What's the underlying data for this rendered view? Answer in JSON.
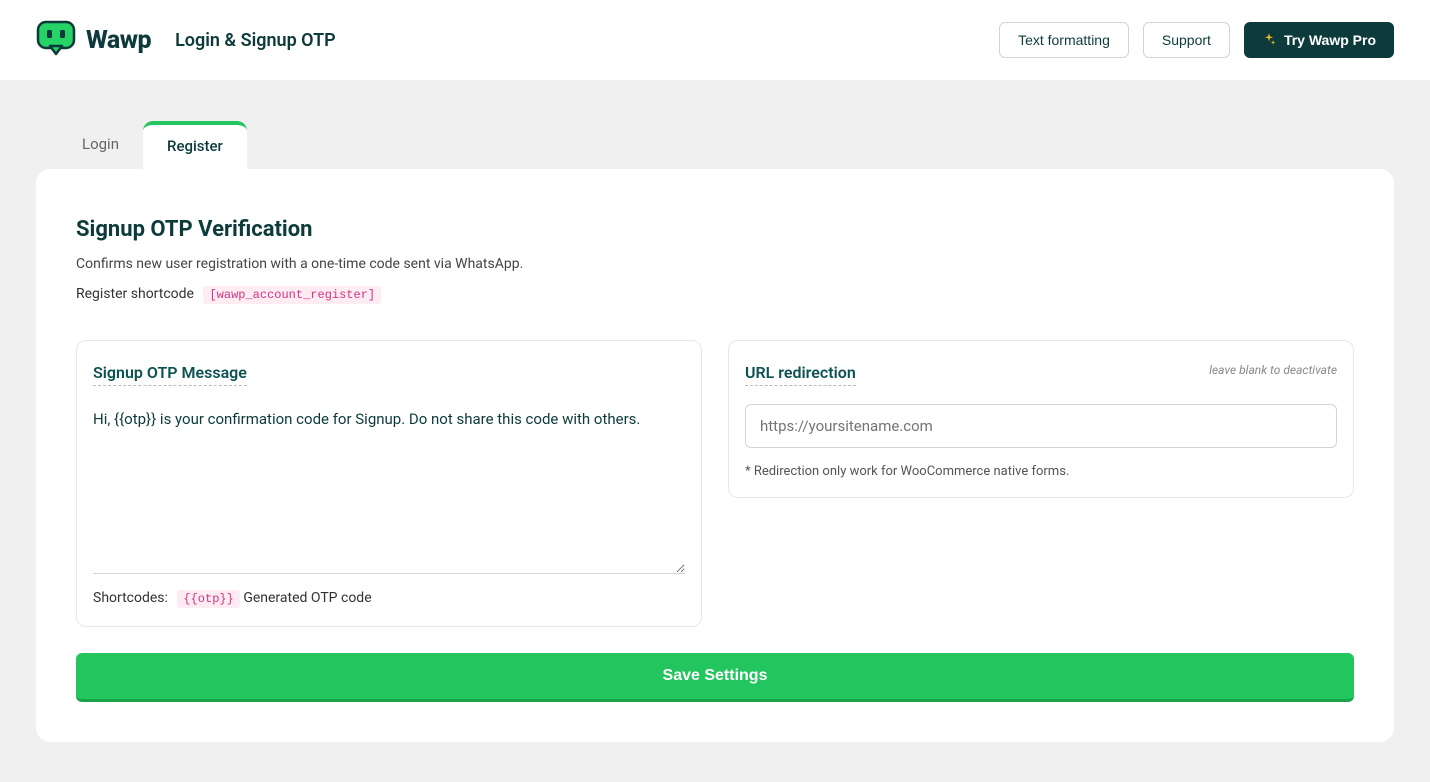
{
  "header": {
    "brand": "Wawp",
    "subtitle": "Login & Signup OTP",
    "text_formatting_btn": "Text formatting",
    "support_btn": "Support",
    "pro_btn": "Try Wawp Pro"
  },
  "tabs": {
    "login": "Login",
    "register": "Register"
  },
  "main": {
    "title": "Signup OTP Verification",
    "description": "Confirms new user registration with a one-time code sent via WhatsApp.",
    "register_shortcode_label": "Register shortcode",
    "register_shortcode_value": "[wawp_account_register]"
  },
  "message_panel": {
    "title": "Signup OTP Message",
    "value": "Hi, {{otp}} is your confirmation code for Signup. Do not share this code with others.",
    "shortcodes_label": "Shortcodes:",
    "shortcode_tag": "{{otp}}",
    "shortcode_desc": "Generated OTP code"
  },
  "url_panel": {
    "title": "URL redirection",
    "hint": "leave blank to deactivate",
    "placeholder": "https://yoursitename.com",
    "note": "* Redirection only work for WooCommerce native forms."
  },
  "footer": {
    "save_btn": "Save Settings"
  }
}
